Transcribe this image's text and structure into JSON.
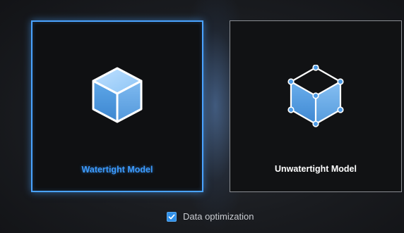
{
  "model_options": [
    {
      "label": "Watertight Model",
      "icon": "solid-cube-icon",
      "selected": true
    },
    {
      "label": "Unwatertight Model",
      "icon": "wireframe-cube-icon",
      "selected": false
    }
  ],
  "data_optimization": {
    "label": "Data optimization",
    "checked": true
  },
  "colors": {
    "accent": "#4aa3ff",
    "selected_label": "#3c9bff",
    "unselected_label": "#ffffff",
    "checkbox": "#2f8fe8"
  }
}
